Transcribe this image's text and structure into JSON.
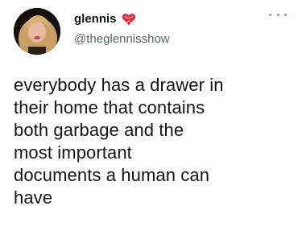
{
  "author": {
    "display_name": "glennis",
    "handle": "@theglennisshow",
    "avatar_icon": "avatar-photo",
    "badge_icon": "heart-with-ribbon-icon"
  },
  "tweet": {
    "text": "everybody has a drawer in\ntheir home that contains\nboth garbage and the\nmost important\ndocuments a human can\nhave"
  },
  "menu": {
    "icon": "more-options-icon"
  },
  "colors": {
    "text_primary": "#0f1419",
    "text_secondary": "#536471",
    "icon_muted": "#8b98a5"
  }
}
